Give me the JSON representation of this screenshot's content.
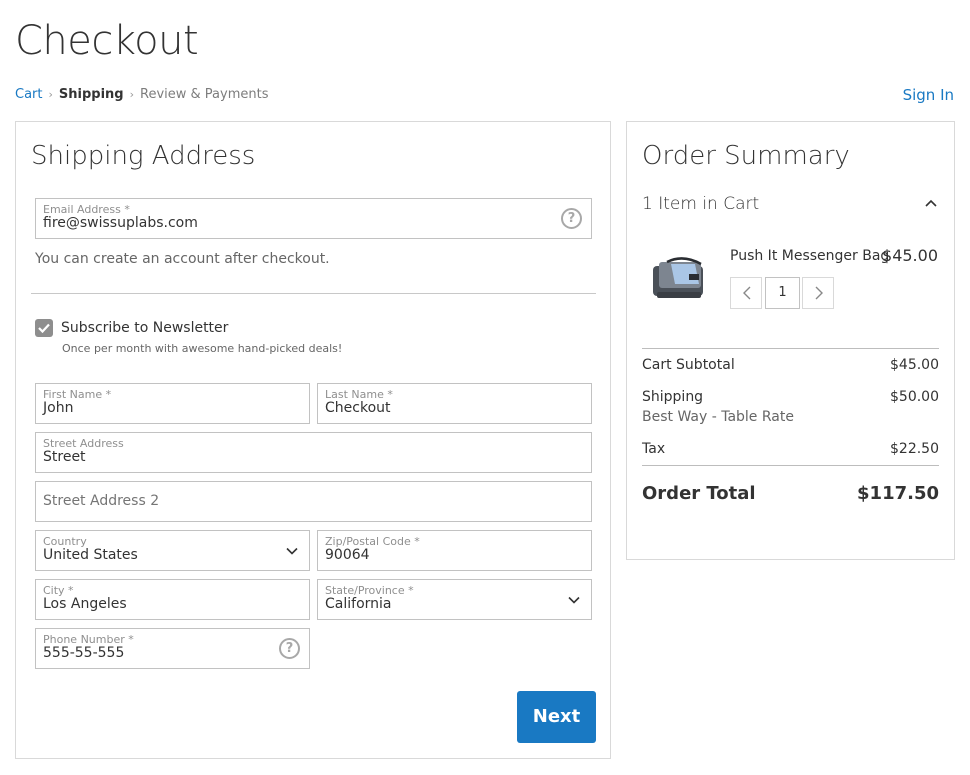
{
  "page": {
    "title": "Checkout"
  },
  "breadcrumb": {
    "cart": "Cart",
    "separator": "›",
    "shipping": "Shipping",
    "review": "Review & Payments"
  },
  "header": {
    "sign_in": "Sign In"
  },
  "shipping": {
    "title": "Shipping Address",
    "email": {
      "label": "Email Address *",
      "value": "fire@swissuplabs.com"
    },
    "account_hint": "You can create an account after checkout.",
    "newsletter": {
      "label": "Subscribe to Newsletter",
      "note": "Once per month with awesome hand-picked deals!",
      "checked": true
    },
    "first_name": {
      "label": "First Name *",
      "value": "John"
    },
    "last_name": {
      "label": "Last Name *",
      "value": "Checkout"
    },
    "street": {
      "label": "Street Address",
      "value": "Street"
    },
    "street2": {
      "placeholder": "Street Address 2"
    },
    "country": {
      "label": "Country",
      "value": "United States"
    },
    "zip": {
      "label": "Zip/Postal Code *",
      "value": "90064"
    },
    "city": {
      "label": "City *",
      "value": "Los Angeles"
    },
    "state": {
      "label": "State/Province *",
      "value": "California"
    },
    "phone": {
      "label": "Phone Number *",
      "value": "555-55-555"
    },
    "help_glyph": "?",
    "next_label": "Next"
  },
  "summary": {
    "title": "Order Summary",
    "items_count": "1 Item in Cart",
    "item": {
      "name": "Push It Messenger Bag",
      "price": "$45.00",
      "qty": "1"
    },
    "subtotal": {
      "label": "Cart Subtotal",
      "value": "$45.00"
    },
    "shipping": {
      "label": "Shipping",
      "method": "Best Way - Table Rate",
      "value": "$50.00"
    },
    "tax": {
      "label": "Tax",
      "value": "$22.50"
    },
    "total": {
      "label": "Order Total",
      "value": "$117.50"
    }
  },
  "icons": {
    "help": "help-icon",
    "chevron_down": "chevron-down-icon",
    "chevron_up": "chevron-up-icon",
    "check": "check-icon",
    "chevron_left": "chevron-left-icon",
    "chevron_right": "chevron-right-icon"
  },
  "colors": {
    "accent": "#1979c3",
    "text": "#333333",
    "border": "#c2c2c2"
  }
}
